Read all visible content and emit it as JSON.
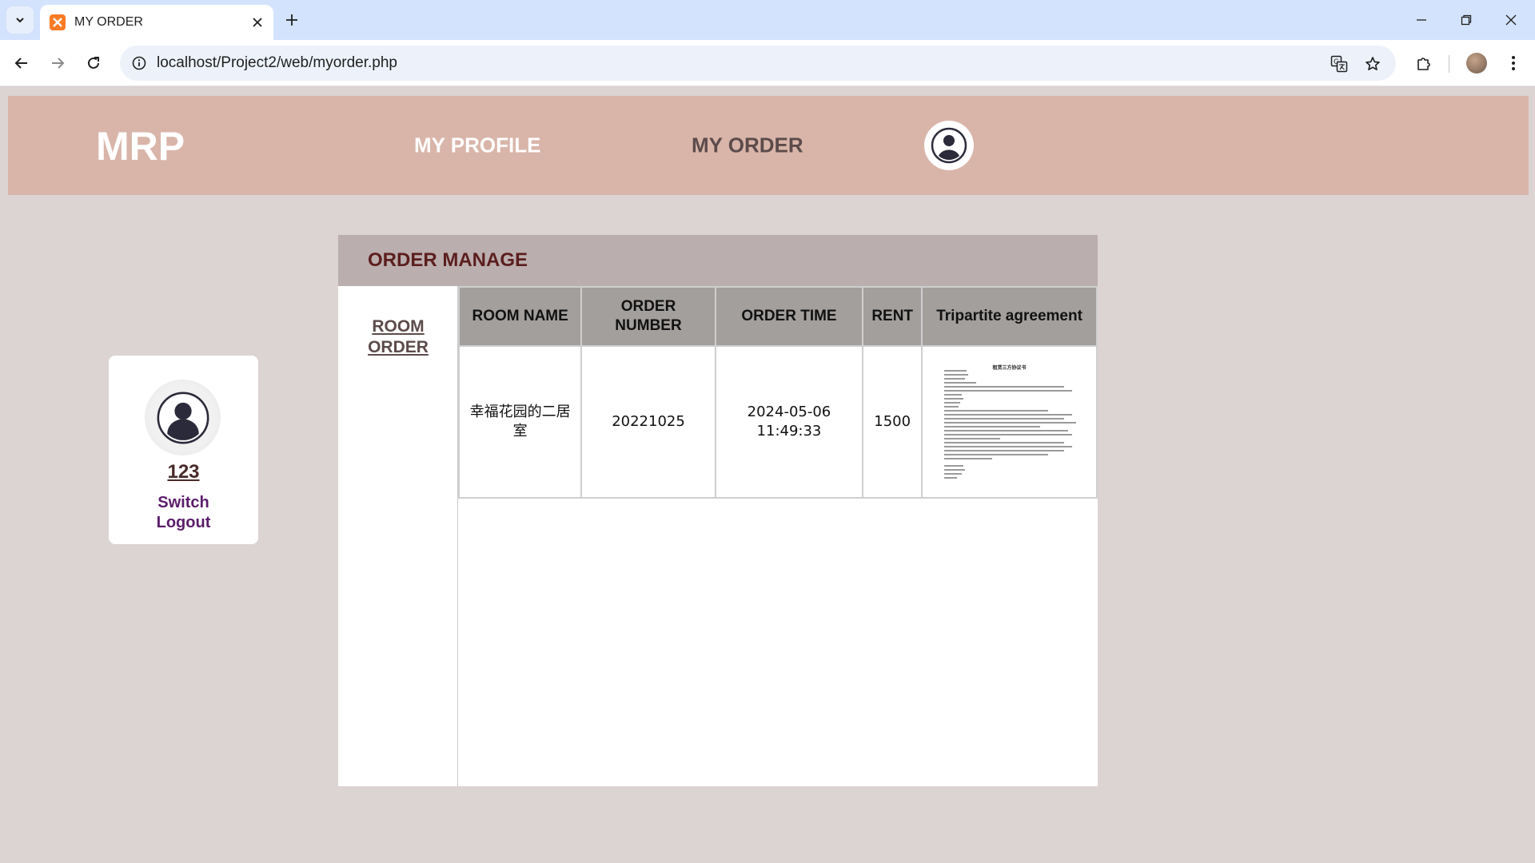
{
  "browser": {
    "tab_title": "MY ORDER",
    "url": "localhost/Project2/web/myorder.php"
  },
  "header": {
    "logo": "MRP",
    "nav": [
      {
        "label": "MY PROFILE",
        "color": "#ffffff"
      },
      {
        "label": "MY ORDER",
        "color": "#5c4b4b"
      }
    ]
  },
  "user_card": {
    "username": "123",
    "links": [
      "Switch",
      "Logout"
    ]
  },
  "panel": {
    "title": "ORDER MANAGE",
    "side_link": "ROOM ORDER",
    "columns": [
      "ROOM NAME",
      "ORDER NUMBER",
      "ORDER TIME",
      "RENT",
      "Tripartite agreement"
    ],
    "rows": [
      {
        "room_name": "幸福花园的二居室",
        "order_number": "20221025",
        "order_time": "2024-05-06 11:49:33",
        "rent": "1500",
        "agreement_heading": "租赁三方协议书"
      }
    ]
  },
  "colors": {
    "header_bg": "#d9b5a9",
    "page_bg": "#dcd3d3",
    "panel_header_bg": "#bbaeae",
    "table_header_bg": "#a29f9d",
    "title_color": "#5c1e1e",
    "link_color": "#5b1d6b"
  }
}
